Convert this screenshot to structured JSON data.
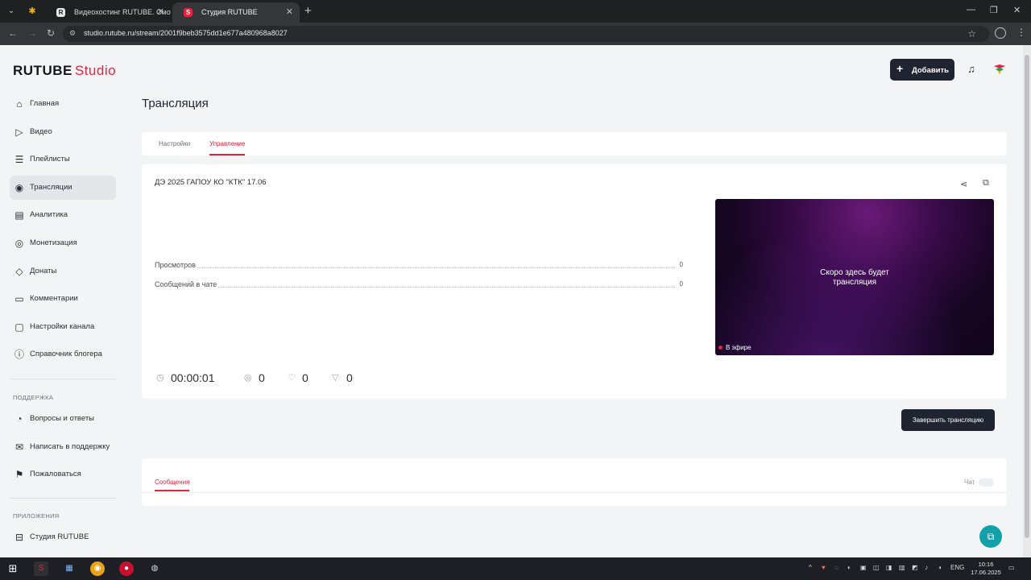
{
  "browser": {
    "tabs": [
      {
        "title": "Видеохостинг RUTUBE. Смотр",
        "favicon": "R"
      },
      {
        "title": "Студия RUTUBE",
        "favicon": "S"
      }
    ],
    "url": "studio.rutube.ru/stream/2001f9beb3575dd1e677a480968a8027"
  },
  "logo": {
    "brand": "RUTUBE",
    "product": "Studio"
  },
  "sidebar": {
    "items": [
      {
        "label": "Главная",
        "icon": "home-icon"
      },
      {
        "label": "Видео",
        "icon": "video-icon"
      },
      {
        "label": "Плейлисты",
        "icon": "playlist-icon"
      },
      {
        "label": "Трансляции",
        "icon": "broadcast-icon",
        "active": true
      },
      {
        "label": "Аналитика",
        "icon": "analytics-icon"
      },
      {
        "label": "Монетизация",
        "icon": "monetization-icon"
      },
      {
        "label": "Донаты",
        "icon": "donations-icon"
      },
      {
        "label": "Комментарии",
        "icon": "comments-icon"
      },
      {
        "label": "Настройки канала",
        "icon": "channel-settings-icon"
      },
      {
        "label": "Справочник блогера",
        "icon": "guide-icon"
      }
    ],
    "support_section": "ПОДДЕРЖКА",
    "support_items": [
      {
        "label": "Вопросы и ответы",
        "icon": "faq-icon"
      },
      {
        "label": "Написать в поддержку",
        "icon": "mail-icon"
      },
      {
        "label": "Пожаловаться",
        "icon": "flag-icon"
      }
    ],
    "apps_section": "ПРИЛОЖЕНИЯ",
    "apps_items": [
      {
        "label": "Студия RUTUBE",
        "icon": "studio-app-icon"
      }
    ]
  },
  "header": {
    "add_label": "Добавить"
  },
  "page": {
    "title": "Трансляция"
  },
  "tabs": [
    {
      "label": "Настройки"
    },
    {
      "label": "Управление",
      "active": true
    }
  ],
  "stream": {
    "title": "ДЭ 2025 ГАПОУ КО \"КТК\" 17.06",
    "stats": [
      {
        "label": "Просмотров",
        "value": "0"
      },
      {
        "label": "Сообщений в чате",
        "value": "0"
      }
    ],
    "player": {
      "message_line1": "Скоро здесь будет",
      "message_line2": "трансляция",
      "live_label": "В эфире"
    },
    "metrics": {
      "duration": "00:00:01",
      "viewers": "0",
      "likes": "0",
      "dislikes": "0"
    },
    "end_label": "Завершить трансляцию"
  },
  "messages": {
    "tab_label": "Сообщения",
    "chat_label": "Чат"
  },
  "taskbar": {
    "language": "ENG",
    "time": "10:16",
    "date": "17.06.2025"
  },
  "colors": {
    "accent": "#e5223f",
    "dark_button": "#1f2430",
    "support_fab": "#12a1a8"
  }
}
